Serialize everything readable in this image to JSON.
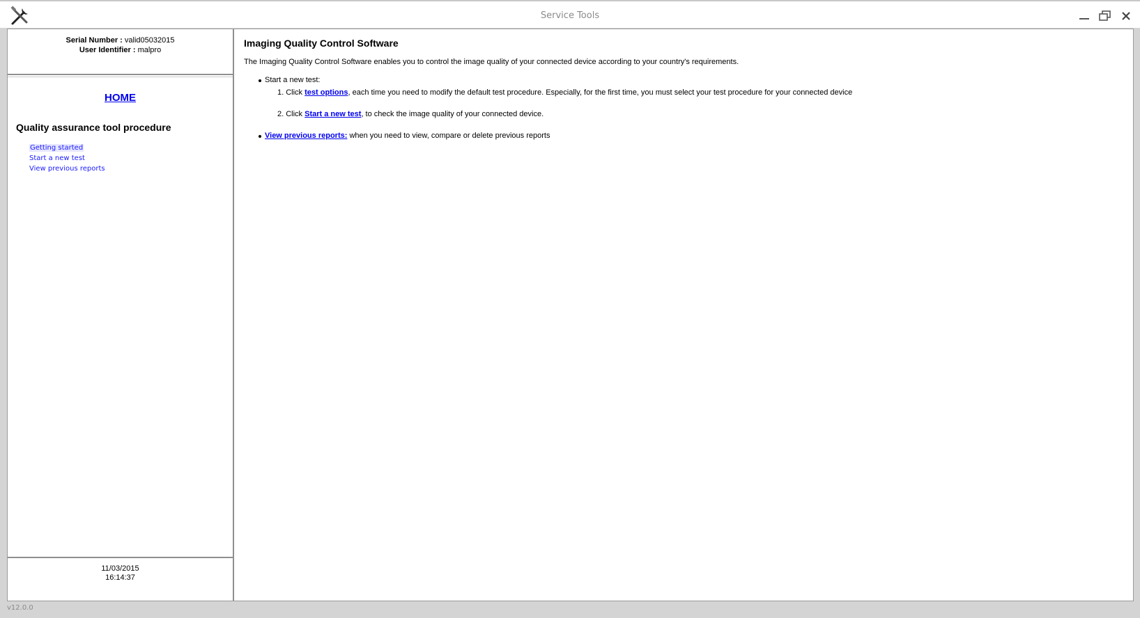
{
  "window": {
    "title": "Service Tools",
    "version": "v12.0.0",
    "icons": {
      "app": "tools-icon",
      "minimize": "minimize-icon",
      "maximize": "restore-icon",
      "close": "close-icon"
    }
  },
  "sidebar": {
    "serial_label": "Serial Number :",
    "serial_value": "valid05032015",
    "user_label": "User Identifier :",
    "user_value": "malpro",
    "home": "HOME",
    "procedure_title": "Quality assurance tool procedure",
    "nav": [
      "Getting started",
      "Start a new test",
      "View previous reports"
    ],
    "date": "11/03/2015",
    "time": "16:14:37"
  },
  "main": {
    "title": "Imaging Quality Control Software",
    "intro": "The Imaging Quality Control Software enables you to control the image quality of your connected device according to your country's requirements.",
    "start_test": "Start a new test:",
    "step1_prefix": "1. Click",
    "step1_link": "test options",
    "step1_suffix": ", each time you need to modify the default test procedure. Especially, for the first time, you must select your test procedure for your connected device",
    "step2_prefix": "2. Click",
    "step2_link": "Start a new test",
    "step2_suffix": ", to check the image quality of your connected device.",
    "reports_link": "View previous reports:",
    "reports_suffix": " when you need to view, compare or delete previous reports"
  }
}
